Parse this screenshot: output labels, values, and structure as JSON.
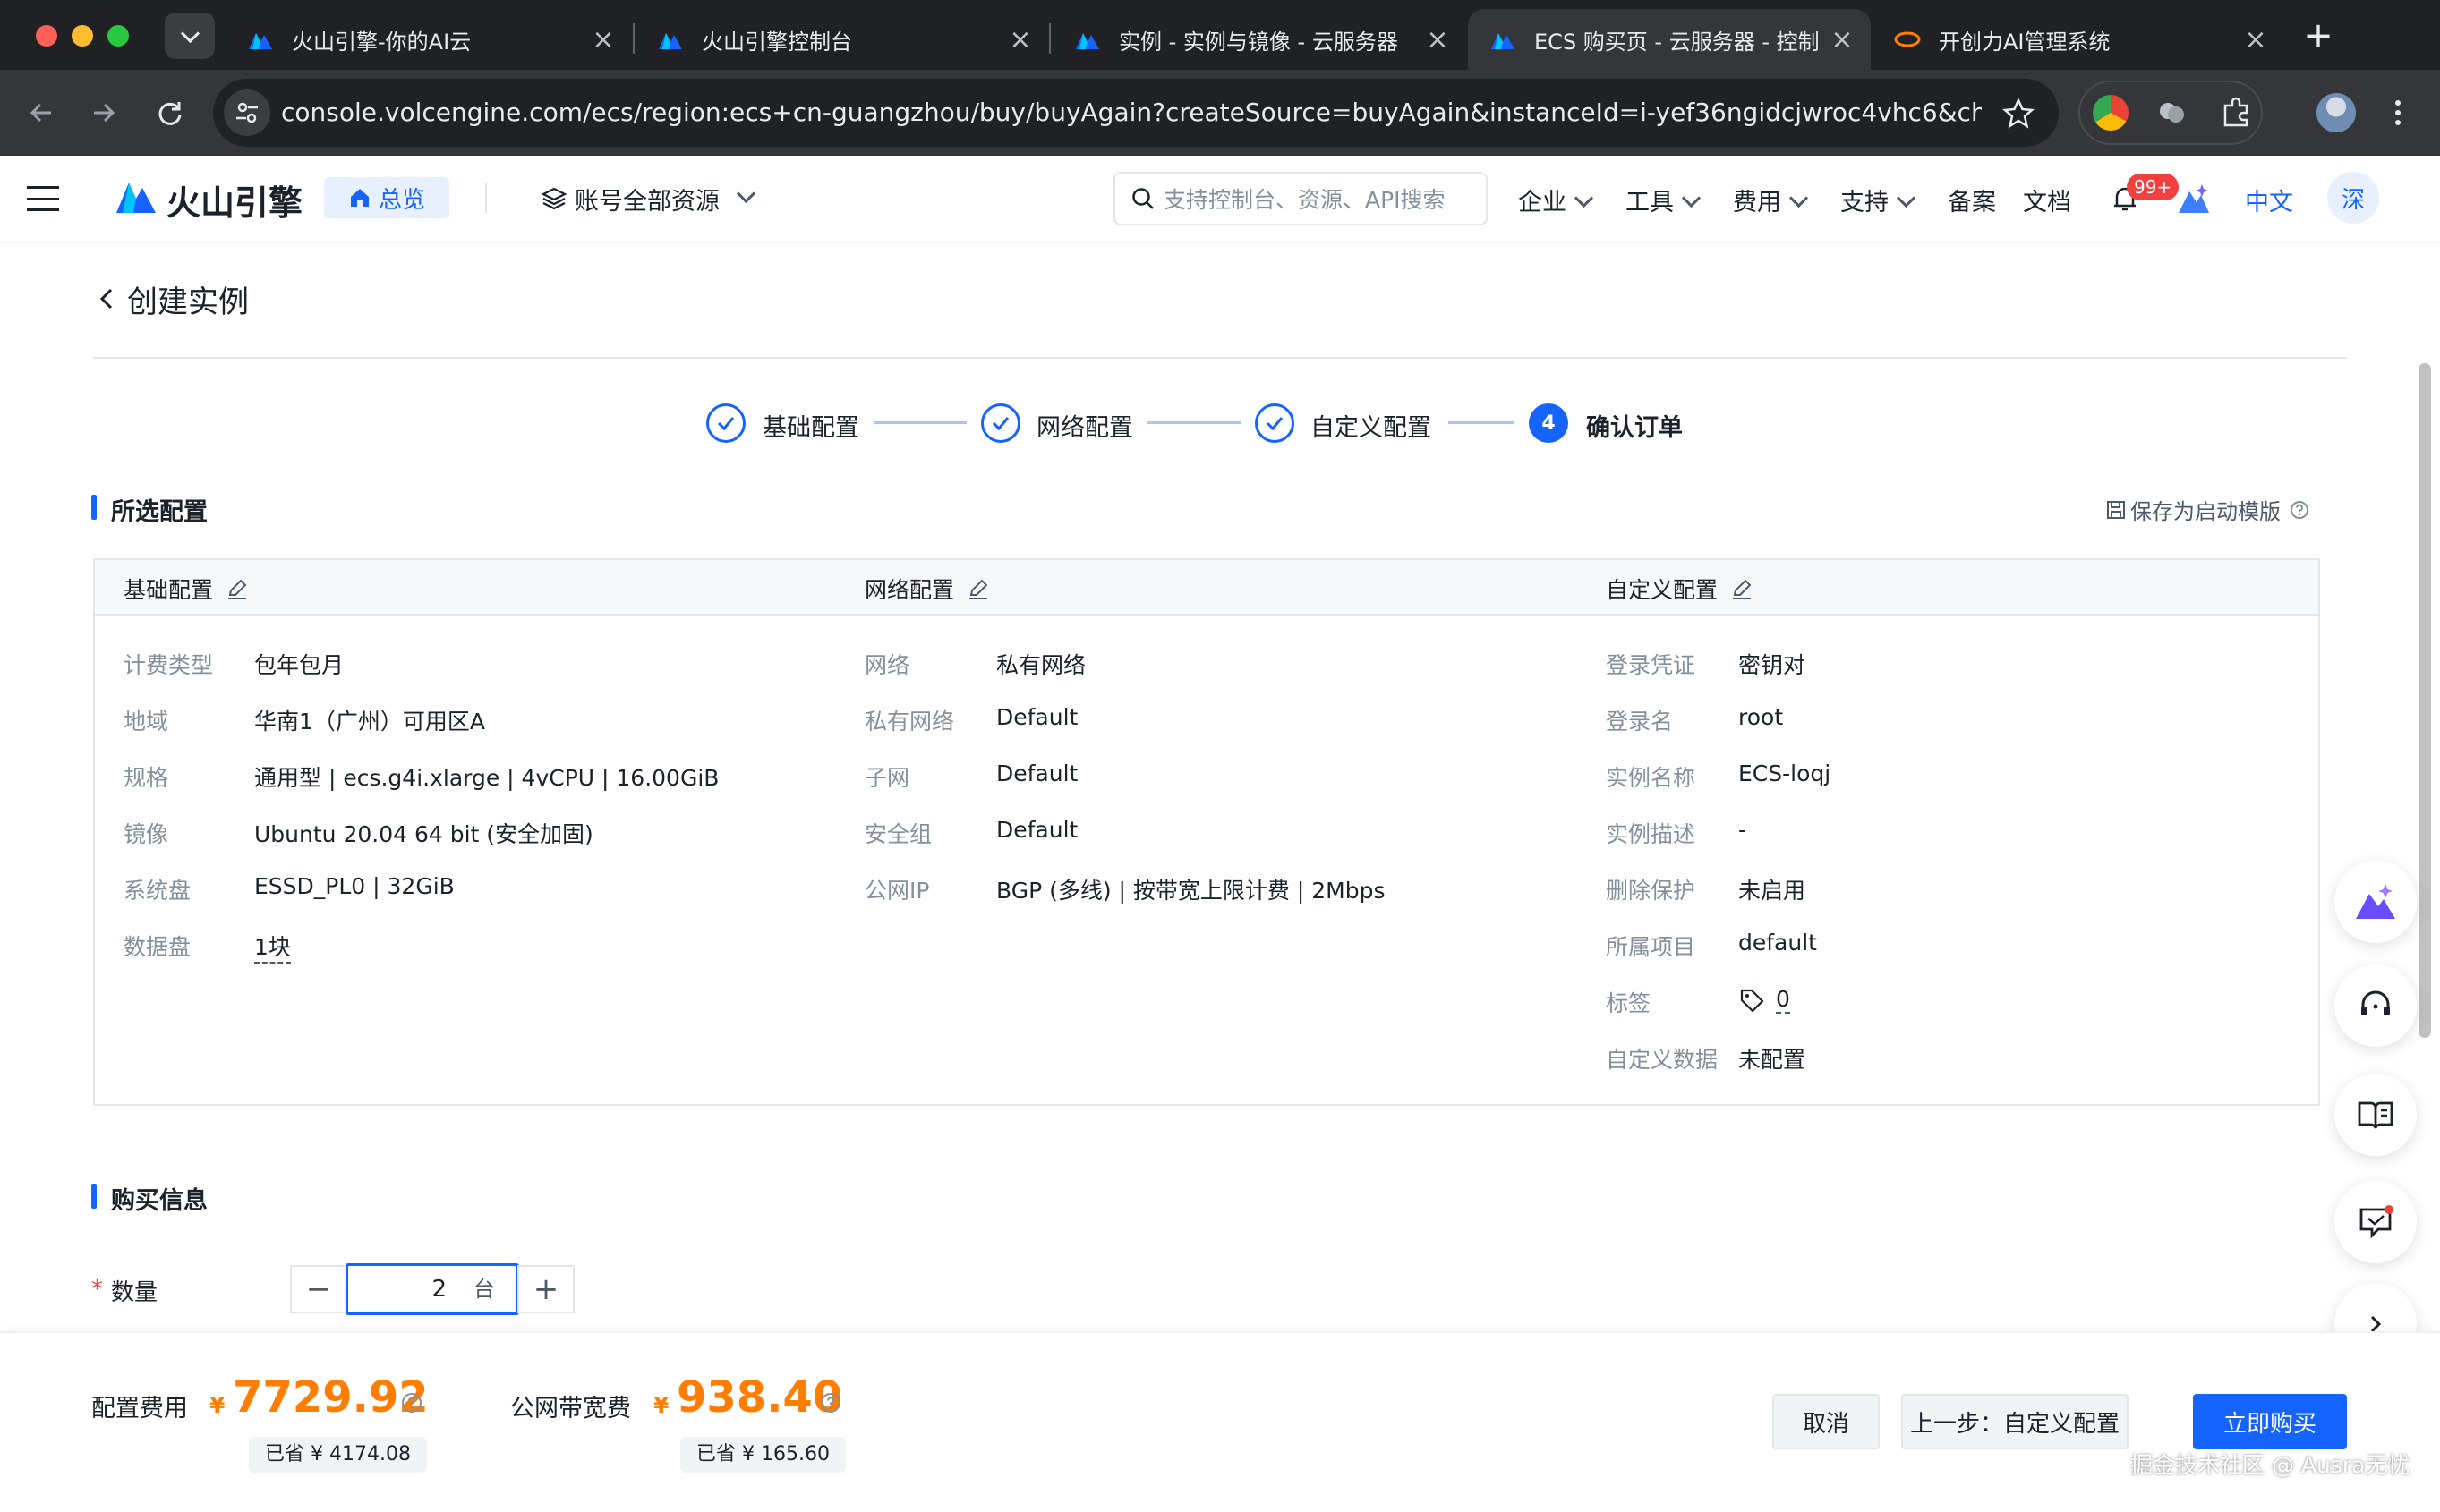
{
  "browser": {
    "tabs": [
      {
        "title": "火山引擎-你的AI云",
        "active": false,
        "icon": "volcano-logo-icon"
      },
      {
        "title": "火山引擎控制台",
        "active": false,
        "icon": "volcano-logo-icon"
      },
      {
        "title": "实例 - 实例与镜像 - 云服务器",
        "active": false,
        "icon": "volcano-logo-icon"
      },
      {
        "title": "ECS 购买页 - 云服务器 - 控制",
        "active": true,
        "icon": "volcano-logo-icon"
      },
      {
        "title": "开创力AI管理系统",
        "active": false,
        "icon": "kcl-logo-icon"
      }
    ],
    "url": "console.volcengine.com/ecs/region:ecs+cn-guangzhou/buy/buyAgain?createSource=buyAgain&instanceId=i-yef36ngidcjwroc4vhc6&chargeT..."
  },
  "header": {
    "brand": "火山引擎",
    "overview": "总览",
    "resource_scope": "账号全部资源",
    "search_placeholder": "支持控制台、资源、API搜索",
    "nav": [
      "企业",
      "工具",
      "费用",
      "支持"
    ],
    "links": [
      "备案",
      "文档"
    ],
    "notification_badge": "99+",
    "language": "中文",
    "avatar": "深"
  },
  "page": {
    "title": "创建实例",
    "steps": [
      {
        "label": "基础配置",
        "status": "done"
      },
      {
        "label": "网络配置",
        "status": "done"
      },
      {
        "label": "自定义配置",
        "status": "done"
      },
      {
        "label": "确认订单",
        "status": "active",
        "number": "4"
      }
    ]
  },
  "selected_config": {
    "title": "所选配置",
    "save_template": "保存为启动模版",
    "columns": [
      {
        "title": "基础配置",
        "rows": [
          {
            "key": "计费类型",
            "value": "包年包月"
          },
          {
            "key": "地域",
            "value": "华南1（广州）可用区A"
          },
          {
            "key": "规格",
            "value": "通用型 | ecs.g4i.xlarge | 4vCPU | 16.00GiB"
          },
          {
            "key": "镜像",
            "value": "Ubuntu 20.04 64 bit (安全加固)"
          },
          {
            "key": "系统盘",
            "value": "ESSD_PL0 | 32GiB"
          },
          {
            "key": "数据盘",
            "value": "1块"
          }
        ]
      },
      {
        "title": "网络配置",
        "rows": [
          {
            "key": "网络",
            "value": "私有网络"
          },
          {
            "key": "私有网络",
            "value": "Default"
          },
          {
            "key": "子网",
            "value": "Default"
          },
          {
            "key": "安全组",
            "value": "Default"
          },
          {
            "key": "公网IP",
            "value": "BGP (多线) | 按带宽上限计费 | 2Mbps"
          }
        ]
      },
      {
        "title": "自定义配置",
        "rows": [
          {
            "key": "登录凭证",
            "value": "密钥对"
          },
          {
            "key": "登录名",
            "value": "root"
          },
          {
            "key": "实例名称",
            "value": "ECS-loqj"
          },
          {
            "key": "实例描述",
            "value": "-"
          },
          {
            "key": "删除保护",
            "value": "未启用"
          },
          {
            "key": "所属项目",
            "value": "default"
          },
          {
            "key": "标签",
            "value": "0"
          },
          {
            "key": "自定义数据",
            "value": "未配置"
          }
        ]
      }
    ]
  },
  "purchase": {
    "title": "购买信息",
    "quantity_label": "数量",
    "quantity_value": "2",
    "quantity_unit": "台"
  },
  "footer": {
    "config_fee_label": "配置费用",
    "currency": "¥",
    "config_fee": "7729.92",
    "config_saved": "已省 ¥ 4174.08",
    "bandwidth_fee_label": "公网带宽费",
    "bandwidth_fee": "938.40",
    "bandwidth_saved": "已省 ¥ 165.60",
    "cancel": "取消",
    "previous": "上一步：自定义配置",
    "buy": "立即购买"
  },
  "watermark": "掘金技术社区 @ Ausra无忧",
  "colors": {
    "primary": "#1664ff",
    "price": "#ff7d00",
    "muted": "#86909c"
  }
}
